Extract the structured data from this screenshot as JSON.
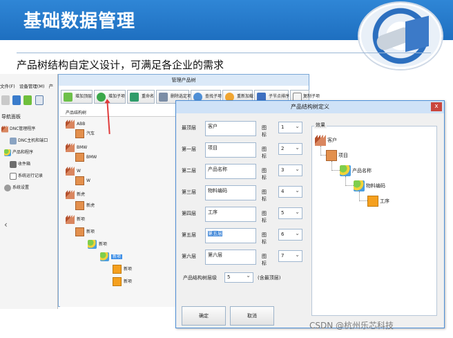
{
  "slide": {
    "title": "基础数据管理",
    "subtitle": "产品树结构自定义设计，可满足各企业的需求"
  },
  "app": {
    "menu": [
      "文件(F)",
      "设备管理(M)",
      "产"
    ],
    "nav_panel_title": "导航面板",
    "nav_items": [
      "DNC管理程序",
      "DNC主机和端口",
      "产品和程序",
      "收件箱",
      "系统运行记录",
      "系统设置"
    ],
    "collapse_glyph": "‹"
  },
  "tree_window": {
    "title": "管理产品树",
    "toolbar": [
      "增加顶层",
      "增加子项",
      "重命名",
      "删除选定项",
      "查找子项",
      "重新加载",
      "子节点排序",
      "复制子项"
    ],
    "panel_label": "产品结构树",
    "nodes": [
      "ABB",
      "汽车",
      "BMW",
      "BMW",
      "W",
      "W",
      "新虎",
      "新虎",
      "新项",
      "新项",
      "新项",
      "新项",
      "新项",
      "新项"
    ]
  },
  "dialog": {
    "title": "产品结构树定义",
    "close_glyph": "x",
    "icon_label": "图标",
    "levels": [
      {
        "label": "最顶层",
        "value": "客户",
        "icon": "1"
      },
      {
        "label": "第一层",
        "value": "项目",
        "icon": "2"
      },
      {
        "label": "第二层",
        "value": "产品名称",
        "icon": "3"
      },
      {
        "label": "第三层",
        "value": "物料编码",
        "icon": "4"
      },
      {
        "label": "第四层",
        "value": "工序",
        "icon": "5"
      },
      {
        "label": "第五层",
        "value": "第五层",
        "icon": "6"
      },
      {
        "label": "第六层",
        "value": "第六层",
        "icon": "7"
      }
    ],
    "depth_label": "产品结构树层级",
    "depth_value": "5",
    "depth_note": "(含最顶层)",
    "ok_label": "确定",
    "cancel_label": "取消",
    "effect_label": "效果",
    "effect_nodes": [
      "客户",
      "项目",
      "产品名称",
      "物料编码",
      "工序"
    ]
  },
  "watermark": "CSDN @杭州乐芯科技",
  "colors": {
    "header_blue": "#1e6fc0",
    "selection_blue": "#3a83d7",
    "arrow_red": "#e03a3a"
  }
}
